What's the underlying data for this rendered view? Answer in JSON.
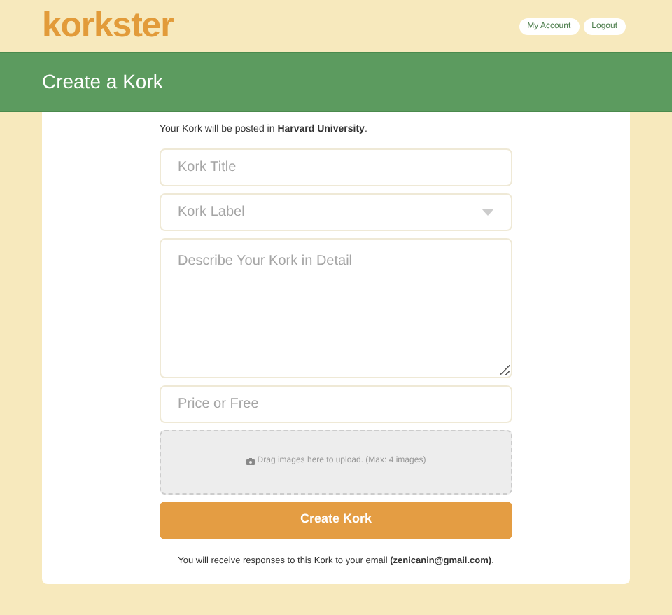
{
  "header": {
    "logo": "korkster",
    "nav": [
      "My Account",
      "Logout"
    ]
  },
  "banner": {
    "title": "Create a Kork"
  },
  "form": {
    "notice": "Your Kork will be posted in **Harvard University**.",
    "title_field": {
      "placeholder": "Kork Title"
    },
    "label_select": {
      "placeholder": "Kork Label"
    },
    "description": {
      "placeholder": "Describe Your Kork in Detail"
    },
    "price_field": {
      "placeholder": "Price or Free"
    },
    "dropzone": "Drag images here to upload. (Max: 4 images)",
    "submit": "Create Kork",
    "footer_note": "You will receive responses to this Kork to your email **(zenicanin@gmail.com)**."
  }
}
